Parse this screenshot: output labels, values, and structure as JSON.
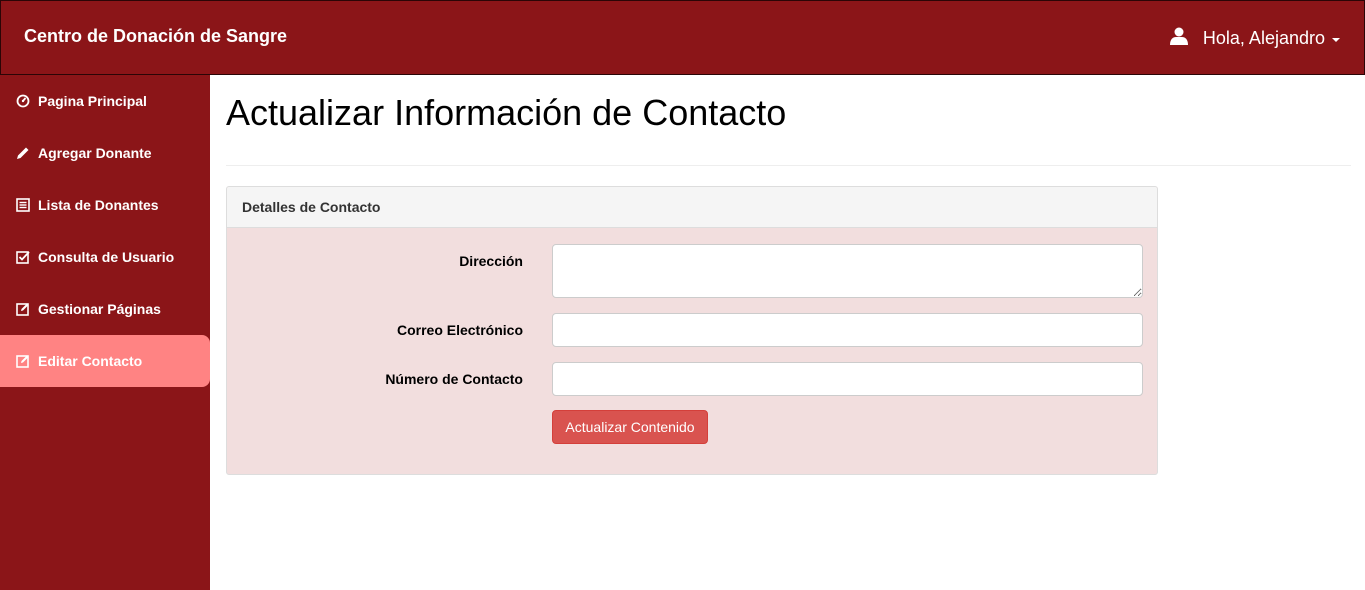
{
  "header": {
    "brand": "Centro de Donación de Sangre",
    "user_greeting": "Hola, Alejandro",
    "user_icon": "user-icon",
    "bg_color": "#8b1518"
  },
  "sidebar": {
    "items": [
      {
        "label": "Pagina Principal",
        "icon": "dashboard-icon"
      },
      {
        "label": "Agregar Donante",
        "icon": "pencil-icon"
      },
      {
        "label": "Lista de Donantes",
        "icon": "list-icon"
      },
      {
        "label": "Consulta de Usuario",
        "icon": "check-square-icon"
      },
      {
        "label": "Gestionar Páginas",
        "icon": "edit-square-icon"
      },
      {
        "label": "Editar Contacto",
        "icon": "edit-square-icon",
        "active": true
      }
    ],
    "active_color": "#ff8383"
  },
  "main": {
    "title": "Actualizar Información de Contacto",
    "panel": {
      "heading": "Detalles de Contacto",
      "fields": {
        "address_label": "Dirección",
        "address_value": "",
        "email_label": "Correo Electrónico",
        "email_value": "",
        "phone_label": "Número de Contacto",
        "phone_value": ""
      },
      "submit_label": "Actualizar Contenido",
      "bg_color": "#f2dede",
      "button_color": "#d9534f"
    }
  }
}
